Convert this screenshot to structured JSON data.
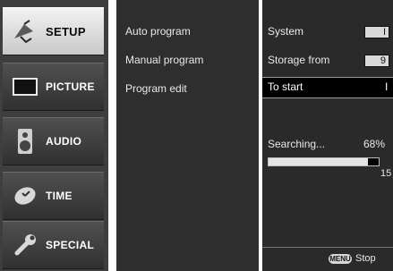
{
  "menu": {
    "items": [
      {
        "label": "SETUP",
        "icon": "satellite-dish-icon",
        "active": true
      },
      {
        "label": "PICTURE",
        "icon": "tv-screen-icon",
        "active": false
      },
      {
        "label": "AUDIO",
        "icon": "speaker-icon",
        "active": false
      },
      {
        "label": "TIME",
        "icon": "clock-icon",
        "active": false
      },
      {
        "label": "SPECIAL",
        "icon": "wrench-icon",
        "active": false
      }
    ]
  },
  "submenu": {
    "items": [
      "Auto program",
      "Manual program",
      "Program edit"
    ]
  },
  "panel": {
    "system_label": "System",
    "system_value": "I",
    "storage_label": "Storage from",
    "storage_value": "9",
    "to_start_label": "To start",
    "to_start_value": "I",
    "searching_label": "Searching...",
    "searching_percent": "68%",
    "progress_fraction": 0.9,
    "count_value": "15",
    "menu_badge": "MENU",
    "stop_label": "Stop"
  },
  "colors": {
    "active_bg": "#e6e6e6",
    "menu_bg": "#3e3e3e",
    "panel_bg": "#2a2a2a"
  }
}
